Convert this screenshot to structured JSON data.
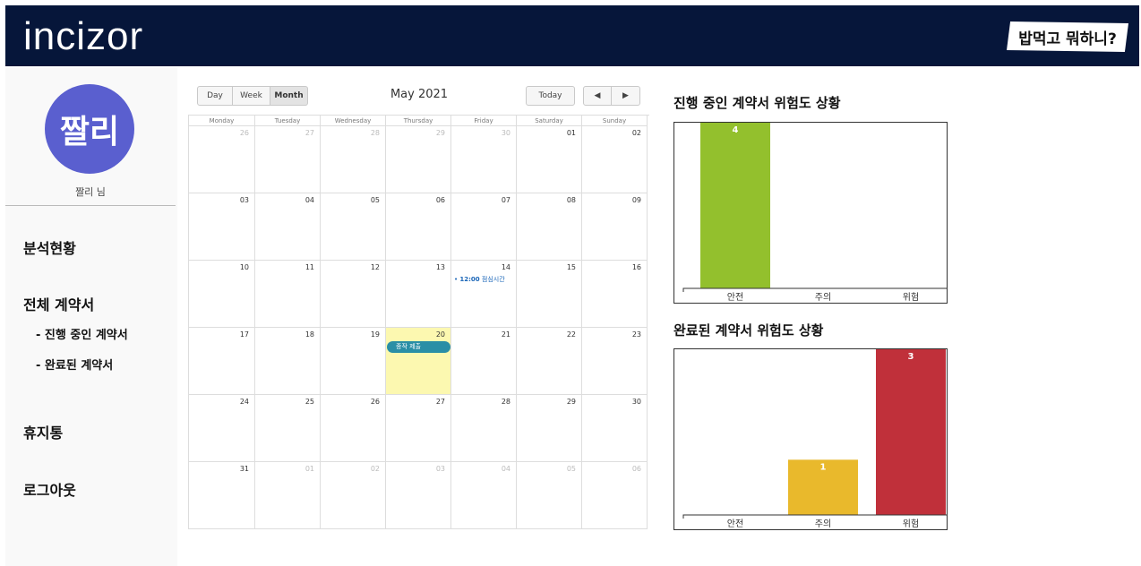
{
  "header": {
    "logo": "incizor",
    "badge": "밥먹고 뭐하니?"
  },
  "sidebar": {
    "avatar_text": "짤리",
    "user_name": "짤리 님",
    "nav": {
      "analysis": "분석현황",
      "all_contracts": "전체 계약서",
      "in_progress": "- 진행 중인 계약서",
      "completed": "- 완료된 계약서",
      "trash": "휴지통",
      "logout": "로그아웃"
    }
  },
  "calendar": {
    "view_buttons": [
      "Day",
      "Week",
      "Month"
    ],
    "active_view": "Month",
    "title": "May 2021",
    "today_label": "Today",
    "prev_icon": "◀",
    "next_icon": "▶",
    "weekdays": [
      "Monday",
      "Tuesday",
      "Wednesday",
      "Thursday",
      "Friday",
      "Saturday",
      "Sunday"
    ],
    "weeks": [
      [
        {
          "d": "26",
          "o": true
        },
        {
          "d": "27",
          "o": true
        },
        {
          "d": "28",
          "o": true
        },
        {
          "d": "29",
          "o": true
        },
        {
          "d": "30",
          "o": true
        },
        {
          "d": "01"
        },
        {
          "d": "02"
        }
      ],
      [
        {
          "d": "03"
        },
        {
          "d": "04"
        },
        {
          "d": "05"
        },
        {
          "d": "06"
        },
        {
          "d": "07"
        },
        {
          "d": "08"
        },
        {
          "d": "09"
        }
      ],
      [
        {
          "d": "10"
        },
        {
          "d": "11"
        },
        {
          "d": "12"
        },
        {
          "d": "13"
        },
        {
          "d": "14"
        },
        {
          "d": "15"
        },
        {
          "d": "16"
        }
      ],
      [
        {
          "d": "17"
        },
        {
          "d": "18"
        },
        {
          "d": "19"
        },
        {
          "d": "20",
          "today": true
        },
        {
          "d": "21"
        },
        {
          "d": "22"
        },
        {
          "d": "23"
        }
      ],
      [
        {
          "d": "24"
        },
        {
          "d": "25"
        },
        {
          "d": "26"
        },
        {
          "d": "27"
        },
        {
          "d": "28"
        },
        {
          "d": "29"
        },
        {
          "d": "30"
        }
      ],
      [
        {
          "d": "31"
        },
        {
          "d": "01",
          "o": true
        },
        {
          "d": "02",
          "o": true
        },
        {
          "d": "03",
          "o": true
        },
        {
          "d": "04",
          "o": true
        },
        {
          "d": "05",
          "o": true
        },
        {
          "d": "06",
          "o": true
        }
      ]
    ],
    "events": [
      {
        "week": 2,
        "day": 4,
        "kind": "timed",
        "time": "12:00",
        "title": "점심시간"
      },
      {
        "week": 3,
        "day": 3,
        "kind": "bar",
        "title": "종작 제출"
      }
    ]
  },
  "chart_data": [
    {
      "type": "bar",
      "title": "진행 중인 계약서 위험도 상황",
      "categories": [
        "안전",
        "주의",
        "위험"
      ],
      "values": [
        4,
        0,
        0
      ],
      "colors": [
        "#93c02d",
        "#e9b92c",
        "#c0303a"
      ],
      "ylim": [
        0,
        4
      ]
    },
    {
      "type": "bar",
      "title": "완료된 계약서 위험도 상황",
      "categories": [
        "안전",
        "주의",
        "위험"
      ],
      "values": [
        0,
        1,
        3
      ],
      "colors": [
        "#93c02d",
        "#e9b92c",
        "#c0303a"
      ],
      "ylim": [
        0,
        3
      ]
    }
  ]
}
